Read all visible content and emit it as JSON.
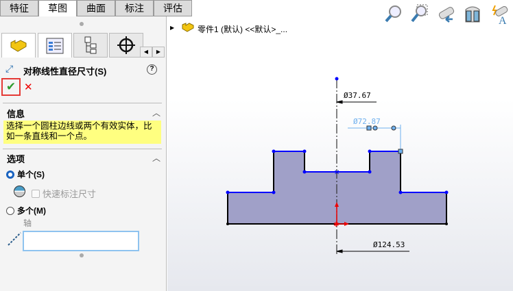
{
  "tabs": [
    "特征",
    "草图",
    "曲面",
    "标注",
    "评估"
  ],
  "active_tab": 1,
  "panel": {
    "title": "对称线性直径尺寸(S)",
    "help": "?",
    "ok": "✔",
    "cancel": "✕",
    "info": {
      "header": "信息",
      "text": "选择一个圆柱边线或两个有效实体，比如一条直线和一个点。"
    },
    "options": {
      "header": "选项",
      "single": "单个(S)",
      "quick_dim": "快速标注尺寸",
      "multiple": "多个(M)",
      "axis_label": "轴",
      "axis_value": ""
    }
  },
  "tree": {
    "label": "零件1 (默认) <<默认>_..."
  },
  "dimensions": {
    "d1": "Ø37.67",
    "d2": "Ø72.87",
    "d3": "Ø124.53"
  },
  "colors": {
    "accent": "#1a63c0",
    "sketch_blue": "#0000ff",
    "highlight": "#ffff80",
    "selected_dim": "#6fb0ee"
  }
}
